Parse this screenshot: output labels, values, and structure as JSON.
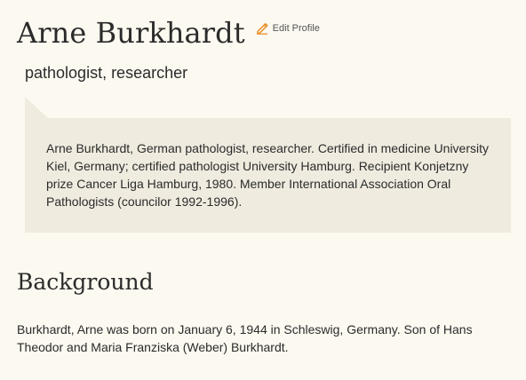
{
  "profile": {
    "name": "Arne Burkhardt",
    "edit_label": "Edit Profile",
    "occupation": "pathologist, researcher"
  },
  "bio": {
    "text": "Arne Burkhardt, German pathologist, researcher. Certified in medicine University Kiel, Germany; certified pathologist University Hamburg. Recipient Konjetzny prize Cancer Liga Hamburg, 1980. Member International Association Oral Pathologists (councilor 1992-1996)."
  },
  "background": {
    "heading": "Background",
    "text": "Burkhardt, Arne was born on January 6, 1944 in Schleswig, Germany. Son of Hans Theodor and Maria Franziska (Weber) Burkhardt."
  },
  "icons": {
    "edit": "pencil-edit-icon"
  },
  "colors": {
    "page_background": "#fcf9f0",
    "bio_background": "#efebdf",
    "edit_icon": "#e8891e",
    "text": "#2b2b2b"
  }
}
